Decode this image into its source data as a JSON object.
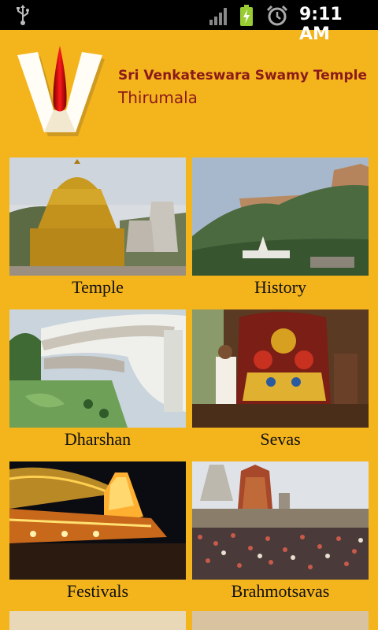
{
  "status_bar": {
    "time": "9:11 AM",
    "icons": [
      "usb-icon",
      "signal-icon",
      "battery-charging-icon",
      "alarm-icon"
    ]
  },
  "header": {
    "title": "Sri Venkateswara Swamy Temple",
    "subtitle": "Thirumala"
  },
  "menu": [
    {
      "label": "Temple"
    },
    {
      "label": "History"
    },
    {
      "label": "Dharshan"
    },
    {
      "label": "Sevas"
    },
    {
      "label": "Festivals"
    },
    {
      "label": "Brahmotsavas"
    }
  ],
  "colors": {
    "background": "#f4b41c",
    "title": "#8b1a1a",
    "status_bar": "#000000"
  }
}
